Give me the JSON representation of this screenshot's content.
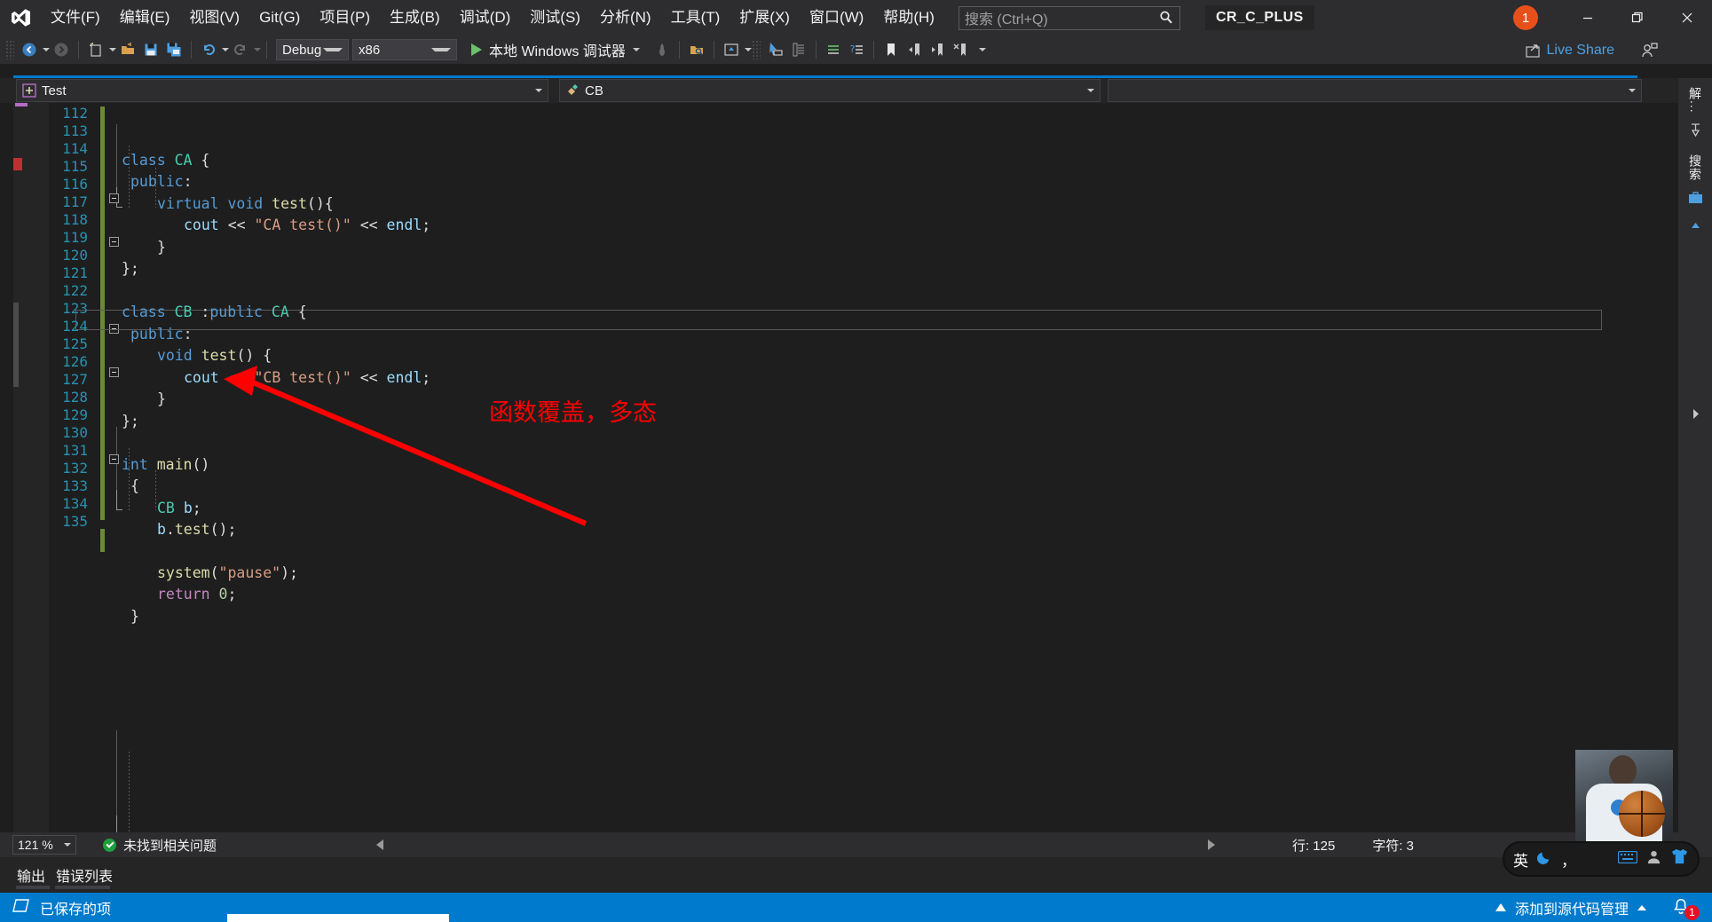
{
  "window": {
    "project_badge": "CR_C_PLUS",
    "notification_count": "1",
    "minimize_icon": "minimize-icon",
    "restore_icon": "restore-icon",
    "close_icon": "close-icon"
  },
  "menubar": {
    "items": [
      {
        "label": "文件(F)",
        "name": "menu-file"
      },
      {
        "label": "编辑(E)",
        "name": "menu-edit"
      },
      {
        "label": "视图(V)",
        "name": "menu-view"
      },
      {
        "label": "Git(G)",
        "name": "menu-git"
      },
      {
        "label": "项目(P)",
        "name": "menu-project"
      },
      {
        "label": "生成(B)",
        "name": "menu-build"
      },
      {
        "label": "调试(D)",
        "name": "menu-debug"
      },
      {
        "label": "测试(S)",
        "name": "menu-test"
      },
      {
        "label": "分析(N)",
        "name": "menu-analyze"
      },
      {
        "label": "工具(T)",
        "name": "menu-tools"
      },
      {
        "label": "扩展(X)",
        "name": "menu-extensions"
      },
      {
        "label": "窗口(W)",
        "name": "menu-window"
      },
      {
        "label": "帮助(H)",
        "name": "menu-help"
      }
    ]
  },
  "search": {
    "placeholder": "搜索 (Ctrl+Q)",
    "value": "",
    "icon": "search-icon"
  },
  "toolbar": {
    "config": "Debug",
    "platform": "x86",
    "run_label": "本地 Windows 调试器",
    "live_share": "Live Share"
  },
  "navbar": {
    "file_selector": "Test",
    "member_selector": "CB",
    "function_selector": ""
  },
  "editor": {
    "first_line": 112,
    "lines": [
      {
        "n": 112,
        "text": ""
      },
      {
        "n": 113,
        "text": "class CA {"
      },
      {
        "n": 114,
        "text": "public:"
      },
      {
        "n": 115,
        "text": "    virtual void test(){"
      },
      {
        "n": 116,
        "text": "        cout << \"CA test()\" << endl;"
      },
      {
        "n": 117,
        "text": "    }"
      },
      {
        "n": 118,
        "text": "};"
      },
      {
        "n": 119,
        "text": ""
      },
      {
        "n": 120,
        "text": "class CB :public CA {"
      },
      {
        "n": 121,
        "text": "public:"
      },
      {
        "n": 122,
        "text": "    void test() {"
      },
      {
        "n": 123,
        "text": "        cout << \"CB test()\" << endl;"
      },
      {
        "n": 124,
        "text": "    }"
      },
      {
        "n": 125,
        "text": "};"
      },
      {
        "n": 126,
        "text": ""
      },
      {
        "n": 127,
        "text": "int main()"
      },
      {
        "n": 128,
        "text": "{"
      },
      {
        "n": 129,
        "text": "    CB b;"
      },
      {
        "n": 130,
        "text": "    b.test();"
      },
      {
        "n": 131,
        "text": ""
      },
      {
        "n": 132,
        "text": "    system(\"pause\");"
      },
      {
        "n": 133,
        "text": "    return 0;"
      },
      {
        "n": 134,
        "text": "}"
      },
      {
        "n": 135,
        "text": ""
      }
    ],
    "current_line": 125,
    "annotation": "函数覆盖，多态",
    "annotation_color": "#fe0000"
  },
  "right_dock": {
    "items": [
      {
        "label": "解...",
        "name": "dock-solution-explorer"
      },
      {
        "label": "搜索",
        "name": "dock-search"
      }
    ]
  },
  "statusline": {
    "zoom": "121 %",
    "problems": "未找到相关问题",
    "line_label": "行: 125",
    "col_label": "字符: 3"
  },
  "panel_tabs": [
    {
      "label": "输出",
      "name": "panel-tab-output"
    },
    {
      "label": "错误列表",
      "name": "panel-tab-error-list"
    }
  ],
  "statusbar": {
    "saved_text": "已保存的项",
    "source_control": "添加到源代码管理",
    "notification_count": "1"
  },
  "ime": {
    "lang": "英",
    "moon": "moon-icon",
    "punct": "，",
    "keyboard": "keyboard-icon",
    "user": "user-icon",
    "skin": "skin-icon"
  },
  "colors": {
    "accent": "#007acc",
    "titlebar": "#2d2d30",
    "editor_bg": "#1e1e1e",
    "linenumber": "#2b91af",
    "keyword": "#569cd6",
    "type": "#4ec9b0",
    "function": "#dcdcaa",
    "string": "#d69d85",
    "number": "#b5cea8",
    "control": "#c586c0",
    "annotation_red": "#fe0000",
    "orange_badge": "#e8501b"
  }
}
